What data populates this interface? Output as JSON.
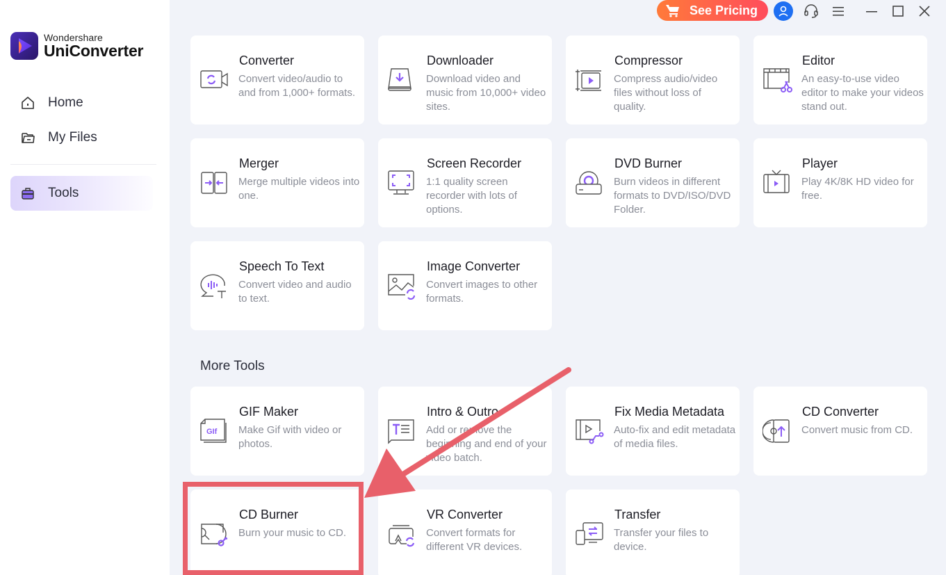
{
  "app": {
    "brand": "Wondershare",
    "product": "UniConverter"
  },
  "sidebar": {
    "items": [
      {
        "label": "Home",
        "icon": "home-icon"
      },
      {
        "label": "My Files",
        "icon": "folder-icon"
      },
      {
        "label": "Tools",
        "icon": "toolbox-icon",
        "active": true
      }
    ]
  },
  "topbar": {
    "pricing_label": "See Pricing",
    "icons": [
      "cart-icon",
      "user-avatar-icon",
      "headset-icon",
      "menu-icon",
      "minimize-icon",
      "maximize-icon",
      "close-icon"
    ]
  },
  "colors": {
    "accent": "#8b5cf6",
    "pricing_gradient_start": "#ff7a3a",
    "pricing_gradient_end": "#ff4c5c",
    "avatar_bg": "#1e6ff2",
    "annotation_red": "#e8606a",
    "background": "#f1f3f9"
  },
  "tools": [
    {
      "title": "Converter",
      "desc": "Convert video/audio to and from 1,000+ formats.",
      "icon": "converter-icon"
    },
    {
      "title": "Downloader",
      "desc": "Download video and music from 10,000+ video sites.",
      "icon": "downloader-icon"
    },
    {
      "title": "Compressor",
      "desc": "Compress audio/video files without loss of quality.",
      "icon": "compressor-icon"
    },
    {
      "title": "Editor",
      "desc": "An easy-to-use video editor to make your videos stand out.",
      "icon": "editor-icon"
    },
    {
      "title": "Merger",
      "desc": "Merge multiple videos into one.",
      "icon": "merger-icon"
    },
    {
      "title": "Screen Recorder",
      "desc": "1:1 quality screen recorder with lots of options.",
      "icon": "screen-recorder-icon"
    },
    {
      "title": "DVD Burner",
      "desc": "Burn videos in different formats to DVD/ISO/DVD Folder.",
      "icon": "dvd-burner-icon"
    },
    {
      "title": "Player",
      "desc": "Play 4K/8K HD video for free.",
      "icon": "player-icon"
    },
    {
      "title": "Speech To Text",
      "desc": "Convert video and audio to text.",
      "icon": "speech-to-text-icon"
    },
    {
      "title": "Image Converter",
      "desc": "Convert images to other formats.",
      "icon": "image-converter-icon"
    }
  ],
  "more_tools": {
    "title": "More Tools",
    "items": [
      {
        "title": "GIF Maker",
        "desc": "Make Gif with video or photos.",
        "icon": "gif-maker-icon"
      },
      {
        "title": "Intro & Outro",
        "desc": "Add or remove the beginning and end of your video batch.",
        "icon": "intro-outro-icon"
      },
      {
        "title": "Fix Media Metadata",
        "desc": "Auto-fix and edit metadata of media files.",
        "icon": "metadata-icon"
      },
      {
        "title": "CD Converter",
        "desc": "Convert music from CD.",
        "icon": "cd-converter-icon"
      },
      {
        "title": "CD Burner",
        "desc": "Burn your music to CD.",
        "icon": "cd-burner-icon",
        "highlighted": true
      },
      {
        "title": "VR Converter",
        "desc": "Convert formats for different VR devices.",
        "icon": "vr-converter-icon"
      },
      {
        "title": "Transfer",
        "desc": "Transfer your files to device.",
        "icon": "transfer-icon"
      }
    ]
  },
  "annotation": {
    "type": "arrow-and-box",
    "target": "CD Burner"
  }
}
